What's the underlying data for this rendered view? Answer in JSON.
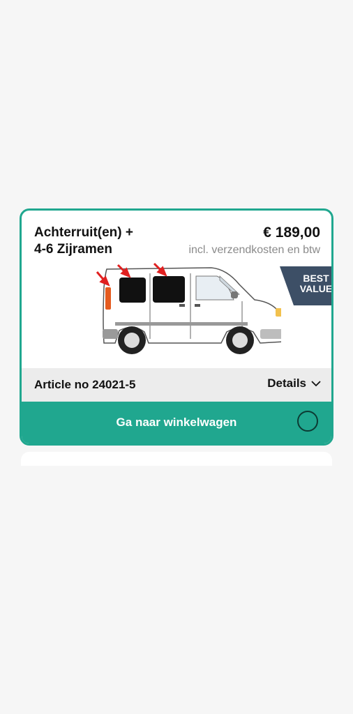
{
  "product": {
    "title_line1": "Achterruit(en) +",
    "title_line2": "4-6 Zijramen",
    "price": "€ 189,00",
    "price_note": "incl. verzendkosten en btw",
    "badge_line1": "BEST",
    "badge_line2": "VALUE",
    "article_label": "Article no 24021-5",
    "details_label": "Details",
    "cta_label": "Ga naar winkelwagen"
  },
  "colors": {
    "accent": "#20a78f",
    "badge": "#3d4f66",
    "info_bar": "#ececec",
    "arrow_red": "#e02020"
  },
  "icons": {
    "details": "chevron-down-icon",
    "cta_status": "loading-spinner-icon"
  }
}
